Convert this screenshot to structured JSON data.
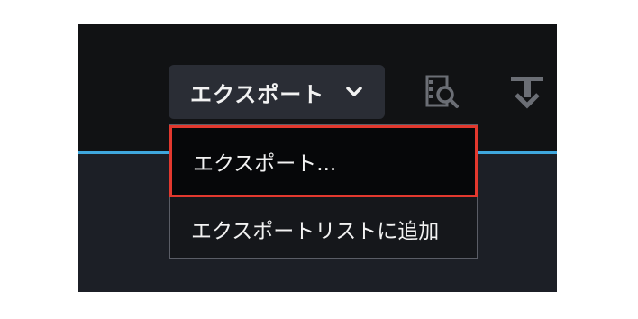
{
  "toolbar": {
    "export_button_label": "エクスポート",
    "icons": [
      "chevron-down-icon",
      "search-clip-icon",
      "download-icon"
    ]
  },
  "dropdown": {
    "items": [
      {
        "label": "エクスポート...",
        "highlighted": true
      },
      {
        "label": "エクスポートリストに追加",
        "highlighted": false
      }
    ]
  },
  "colors": {
    "panel_bg": "#111214",
    "accent_line": "#3fa7dd",
    "highlight_border": "#e2382e",
    "text": "#f2f2f2"
  }
}
